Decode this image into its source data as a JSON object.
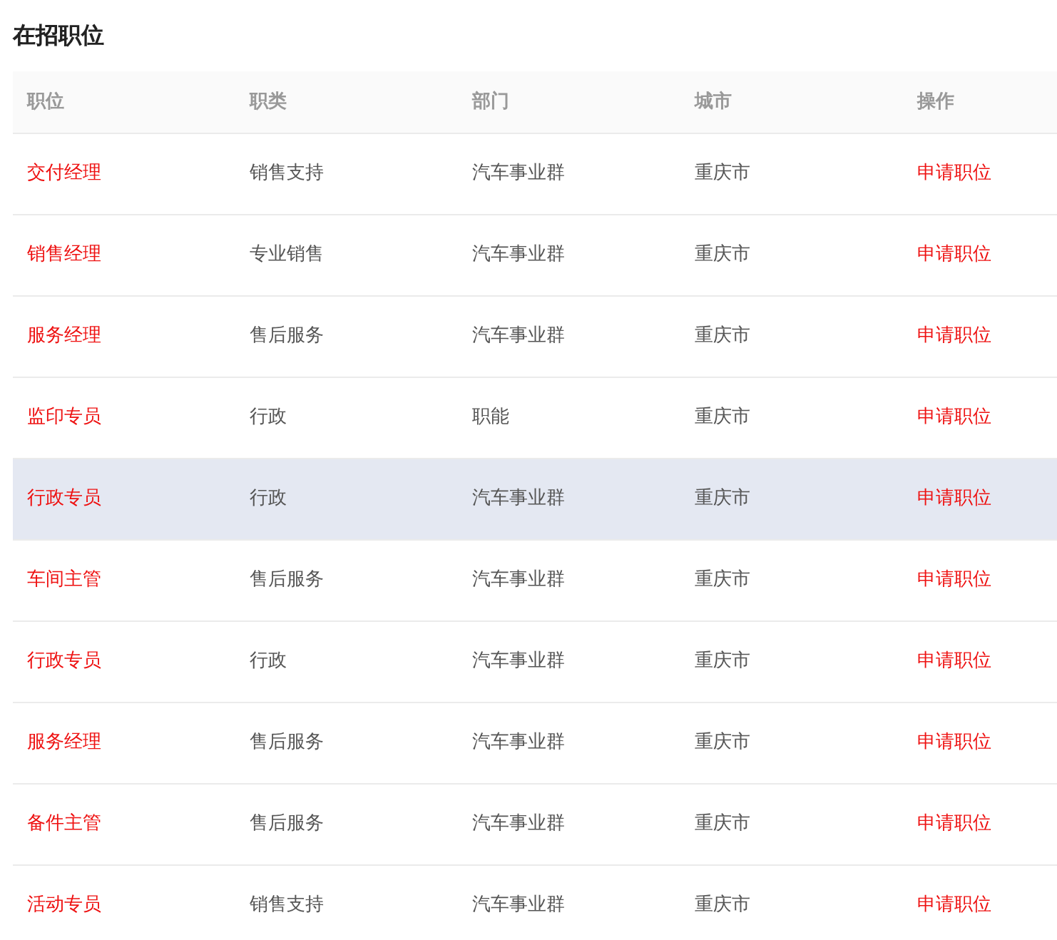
{
  "title": "在招职位",
  "table": {
    "columns": [
      "职位",
      "职类",
      "部门",
      "城市",
      "操作"
    ],
    "rows": [
      {
        "position": "交付经理",
        "category": "销售支持",
        "department": "汽车事业群",
        "city": "重庆市",
        "action": "申请职位",
        "highlighted": false
      },
      {
        "position": "销售经理",
        "category": "专业销售",
        "department": "汽车事业群",
        "city": "重庆市",
        "action": "申请职位",
        "highlighted": false
      },
      {
        "position": "服务经理",
        "category": "售后服务",
        "department": "汽车事业群",
        "city": "重庆市",
        "action": "申请职位",
        "highlighted": false
      },
      {
        "position": "监印专员",
        "category": "行政",
        "department": "职能",
        "city": "重庆市",
        "action": "申请职位",
        "highlighted": false
      },
      {
        "position": "行政专员",
        "category": "行政",
        "department": "汽车事业群",
        "city": "重庆市",
        "action": "申请职位",
        "highlighted": true
      },
      {
        "position": "车间主管",
        "category": "售后服务",
        "department": "汽车事业群",
        "city": "重庆市",
        "action": "申请职位",
        "highlighted": false
      },
      {
        "position": "行政专员",
        "category": "行政",
        "department": "汽车事业群",
        "city": "重庆市",
        "action": "申请职位",
        "highlighted": false
      },
      {
        "position": "服务经理",
        "category": "售后服务",
        "department": "汽车事业群",
        "city": "重庆市",
        "action": "申请职位",
        "highlighted": false
      },
      {
        "position": "备件主管",
        "category": "售后服务",
        "department": "汽车事业群",
        "city": "重庆市",
        "action": "申请职位",
        "highlighted": false
      },
      {
        "position": "活动专员",
        "category": "销售支持",
        "department": "汽车事业群",
        "city": "重庆市",
        "action": "申请职位",
        "highlighted": false
      }
    ]
  }
}
